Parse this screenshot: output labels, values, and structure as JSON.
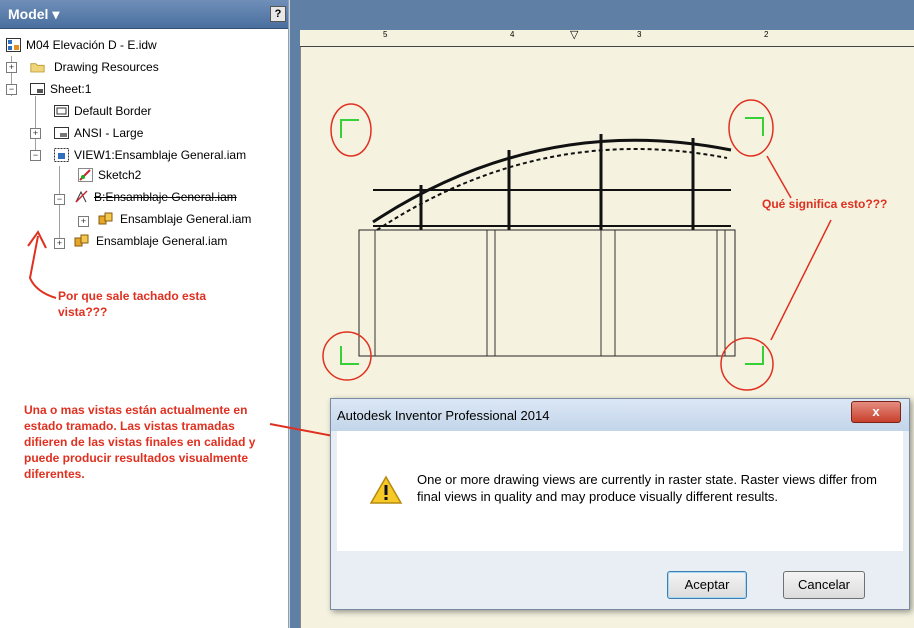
{
  "panel": {
    "title": "Model ▾",
    "help": "?"
  },
  "tree": {
    "root": "M04 Elevación D - E.idw",
    "drawing_resources": "Drawing Resources",
    "sheet": "Sheet:1",
    "default_border": "Default Border",
    "ansi": "ANSI - Large",
    "view1": "VIEW1:Ensamblaje General.iam",
    "sketch2": "Sketch2",
    "viewb": "B:Ensamblaje General.iam",
    "ens_child": "Ensamblaje General.iam",
    "ens": "Ensamblaje General.iam"
  },
  "annotations": {
    "tachado": "Por que sale tachado esta\nvista???",
    "significa": "Qué significa esto???",
    "traduccion": "Una o mas vistas están actualmente en\nestado tramado. Las vistas tramadas\ndifieren de las vistas finales en calidad y\npuede producir resultados visualmente\ndiferentes."
  },
  "dialog": {
    "title": "Autodesk Inventor Professional 2014",
    "close": "x",
    "message": "One or more drawing views are currently in raster state. Raster views differ from final views in quality and may produce visually different results.",
    "ok": "Aceptar",
    "cancel": "Cancelar"
  },
  "ruler": {
    "marks": [
      "5",
      "4",
      "3",
      "2"
    ]
  },
  "colors": {
    "annotation": "#e03020",
    "corner_marks": "#37d037",
    "sheet": "#f5f3e0"
  }
}
